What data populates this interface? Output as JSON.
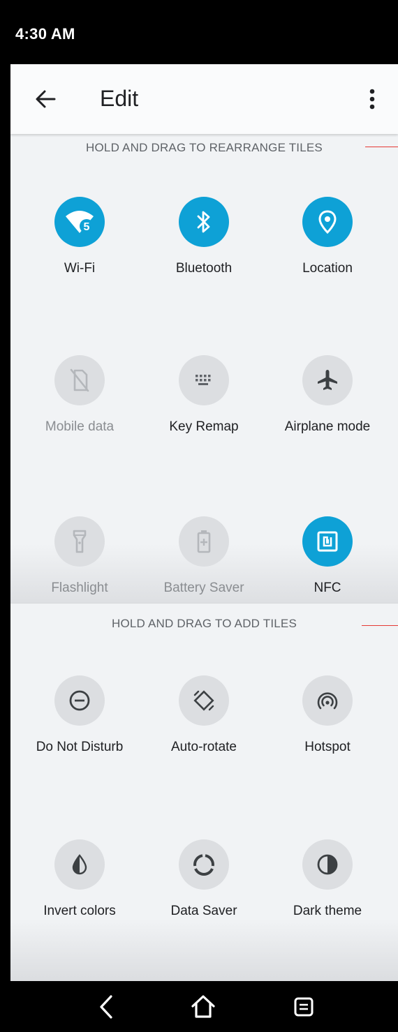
{
  "status_bar": {
    "time": "4:30 AM"
  },
  "header": {
    "title": "Edit",
    "back_icon": "arrow-left-icon",
    "more_icon": "more-vert-icon"
  },
  "active_section": {
    "heading": "HOLD AND DRAG TO REARRANGE TILES",
    "tiles": [
      {
        "label": "Wi-Fi",
        "icon": "wifi-icon",
        "state": "on",
        "badge": "5"
      },
      {
        "label": "Bluetooth",
        "icon": "bluetooth-icon",
        "state": "on"
      },
      {
        "label": "Location",
        "icon": "location-pin-icon",
        "state": "on"
      },
      {
        "label": "Mobile data",
        "icon": "mobile-data-off-icon",
        "state": "unavailable"
      },
      {
        "label": "Key Remap",
        "icon": "keyboard-icon",
        "state": "off"
      },
      {
        "label": "Airplane mode",
        "icon": "airplane-icon",
        "state": "off"
      },
      {
        "label": "Flashlight",
        "icon": "flashlight-icon",
        "state": "unavailable"
      },
      {
        "label": "Battery Saver",
        "icon": "battery-saver-icon",
        "state": "unavailable"
      },
      {
        "label": "NFC",
        "icon": "nfc-icon",
        "state": "on"
      }
    ]
  },
  "available_section": {
    "heading": "HOLD AND DRAG TO ADD TILES",
    "tiles": [
      {
        "label": "Do Not Disturb",
        "icon": "do-not-disturb-icon",
        "state": "off"
      },
      {
        "label": "Auto-rotate",
        "icon": "auto-rotate-icon",
        "state": "off"
      },
      {
        "label": "Hotspot",
        "icon": "hotspot-icon",
        "state": "off"
      },
      {
        "label": "Invert colors",
        "icon": "invert-colors-icon",
        "state": "off"
      },
      {
        "label": "Data Saver",
        "icon": "data-saver-icon",
        "state": "off"
      },
      {
        "label": "Dark theme",
        "icon": "dark-theme-icon",
        "state": "off"
      }
    ]
  },
  "colors": {
    "accent": "#0ea1d6",
    "tile_off": "#dcdee1",
    "panel_bg": "#f1f3f5"
  },
  "nav_bar": {
    "back_icon": "nav-back-icon",
    "home_icon": "nav-home-icon",
    "recents_icon": "nav-recents-icon"
  }
}
